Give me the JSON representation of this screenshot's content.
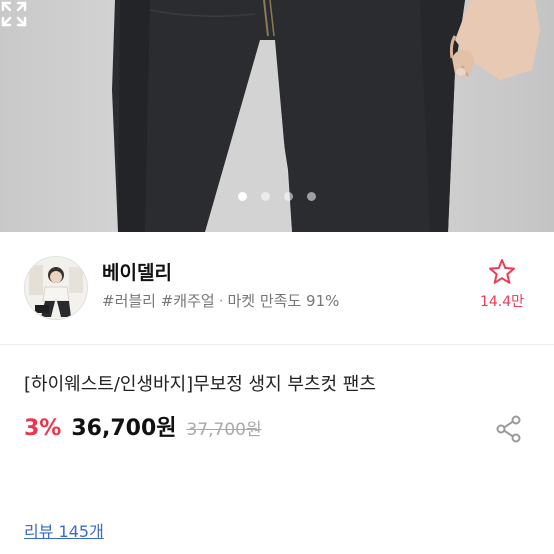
{
  "carousel": {
    "slide_count": 4,
    "active_index": 0,
    "expand_icon": "expand-icon"
  },
  "shop": {
    "name": "베이델리",
    "tags": "#러블리 #캐주얼",
    "satisfaction": "마켓 만족도 91%",
    "favorite_icon": "star-outline-icon",
    "favorite_count": "14.4만"
  },
  "product": {
    "title": "[하이웨스트/인생바지]무보정 생지 부츠컷 팬츠",
    "discount": "3%",
    "price": "36,700원",
    "original_price": "37,700원",
    "share_icon": "share-icon"
  },
  "review": {
    "label": "리뷰 145개"
  },
  "colors": {
    "accent": "#f0334d",
    "link": "#3b6bc8"
  }
}
